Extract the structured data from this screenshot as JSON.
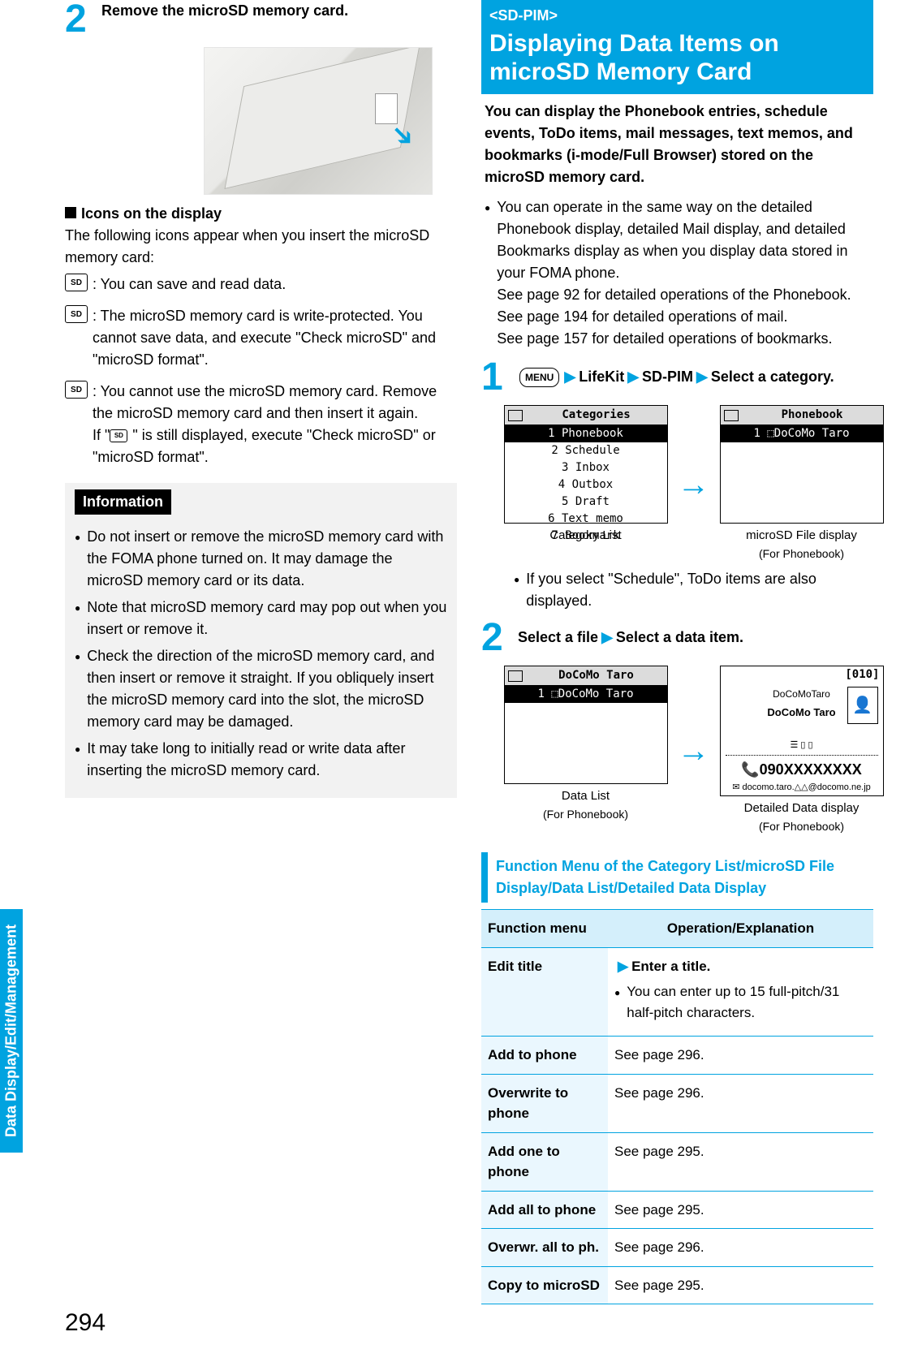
{
  "left": {
    "step2_num": "2",
    "step2_title": "Remove the microSD memory card.",
    "icons_head": "Icons on the display",
    "icons_intro": "The following icons appear when you insert the microSD memory card:",
    "icon1_label": "SD",
    "icon1_text": ": You can save and read data.",
    "icon2_label": "SD",
    "icon2_text": ": The microSD memory card is write-protected. You cannot save data, and execute \"Check microSD\" and \"microSD format\".",
    "icon3_label": "SD",
    "icon3_text_a": ": You cannot use the microSD memory card. Remove the microSD memory card and then insert it again.",
    "icon3_text_b": "If \"  \" is still displayed, execute \"Check microSD\" or \"microSD format\".",
    "info_title": "Information",
    "info1": "Do not insert or remove the microSD memory card with the FOMA phone turned on. It may damage the microSD memory card or its data.",
    "info2": "Note that microSD memory card may pop out when you insert or remove it.",
    "info3": "Check the direction of the microSD memory card, and then insert or remove it straight. If you obliquely insert the microSD memory card into the slot, the microSD memory card may be damaged.",
    "info4": "It may take long to initially read or write data after inserting the microSD memory card."
  },
  "right": {
    "tag": "<SD-PIM>",
    "title": "Displaying Data Items on microSD Memory Card",
    "intro_bold": "You can display the Phonebook entries, schedule events, ToDo items, mail messages, text memos, and bookmarks (i-mode/Full Browser) stored on the microSD memory card.",
    "b1": "You can operate in the same way on the detailed Phonebook display, detailed Mail display, and detailed Bookmarks display as when you display data stored in your FOMA phone.",
    "b1a": "See page 92 for detailed operations of the Phonebook.",
    "b1b": "See page 194 for detailed operations of mail.",
    "b1c": "See page 157 for detailed operations of bookmarks.",
    "step1_num": "1",
    "menu_label": "MENU",
    "nav1": "LifeKit",
    "nav2": "SD-PIM",
    "nav3": "Select a category.",
    "cat_screen_title": "Categories",
    "cat_items": [
      "Phonebook",
      "Schedule",
      "Inbox",
      "Outbox",
      "Draft",
      "Text memo",
      "Bookmark"
    ],
    "pb_screen_title": "Phonebook",
    "pb_item1": "DoCoMo Taro",
    "cap_cat": "Category List",
    "cap_pb": "microSD File display",
    "cap_pb2": "(For Phonebook)",
    "note1": "If you select \"Schedule\", ToDo items are also displayed.",
    "step2_num": "2",
    "step2_title": "Select a file",
    "step2_title_b": "Select a data item.",
    "dl_title": "DoCoMo Taro",
    "dl_item": "DoCoMo Taro",
    "dd_count": "[010]",
    "dd_name_k": "DoCoMoTaro",
    "dd_name": "DoCoMo Taro",
    "dd_phone": "090XXXXXXXX",
    "dd_mail": "docomo.taro.△△@docomo.ne.jp",
    "cap_dl": "Data List",
    "cap_dl2": "(For Phonebook)",
    "cap_dd": "Detailed Data display",
    "cap_dd2": "(For Phonebook)",
    "func_head": "Function Menu of the Category List/microSD File Display/Data List/Detailed Data Display",
    "th1": "Function menu",
    "th2": "Operation/Explanation",
    "row1_h": "Edit title",
    "row1_a": "Enter a title.",
    "row1_b": "You can enter up to 15 full-pitch/31 half-pitch characters.",
    "row2_h": "Add to phone",
    "row2_t": "See page 296.",
    "row3_h": "Overwrite to phone",
    "row3_t": "See page 296.",
    "row4_h": "Add one to phone",
    "row4_t": "See page 295.",
    "row5_h": "Add all to phone",
    "row5_t": "See page 295.",
    "row6_h": "Overwr. all to ph.",
    "row6_t": "See page 296.",
    "row7_h": "Copy to microSD",
    "row7_t": "See page 295."
  },
  "footer": {
    "side": "Data Display/Edit/Management",
    "page": "294"
  }
}
